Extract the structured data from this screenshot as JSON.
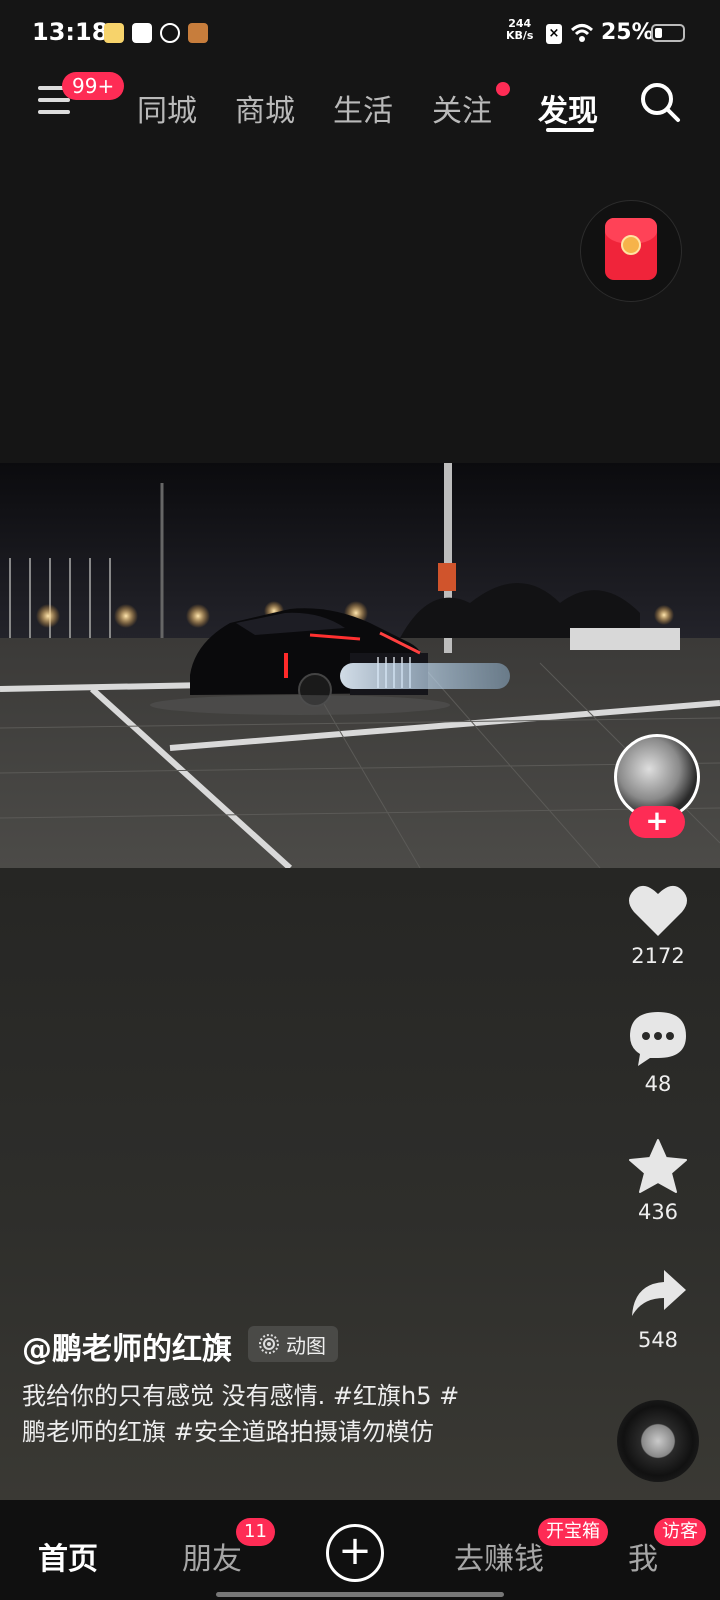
{
  "status_bar": {
    "time": "13:18",
    "net_speed_value": "244",
    "net_speed_unit": "KB/s",
    "battery": "25%",
    "battery_level": 0.25
  },
  "top_nav": {
    "menu_badge": "99+",
    "tabs": [
      {
        "label": "同城",
        "active": false
      },
      {
        "label": "商城",
        "active": false
      },
      {
        "label": "生活",
        "active": false
      },
      {
        "label": "关注",
        "active": false,
        "dot": true
      },
      {
        "label": "发现",
        "active": true
      }
    ]
  },
  "rail": {
    "likes": "2172",
    "comments": "48",
    "favorites": "436",
    "shares": "548"
  },
  "caption": {
    "author": "@鹏老师的红旗",
    "tag": "动图",
    "description": "我给你的只有感觉 没有感情. #红旗h5 #鹏老师的红旗 #安全道路拍摄请勿模仿"
  },
  "bottom_nav": {
    "home": "首页",
    "friends": "朋友",
    "friends_badge": "11",
    "earn": "去赚钱",
    "earn_badge": "开宝箱",
    "me": "我",
    "me_badge": "访客"
  },
  "colors": {
    "accent": "#fe2c55",
    "background": "#141414"
  }
}
